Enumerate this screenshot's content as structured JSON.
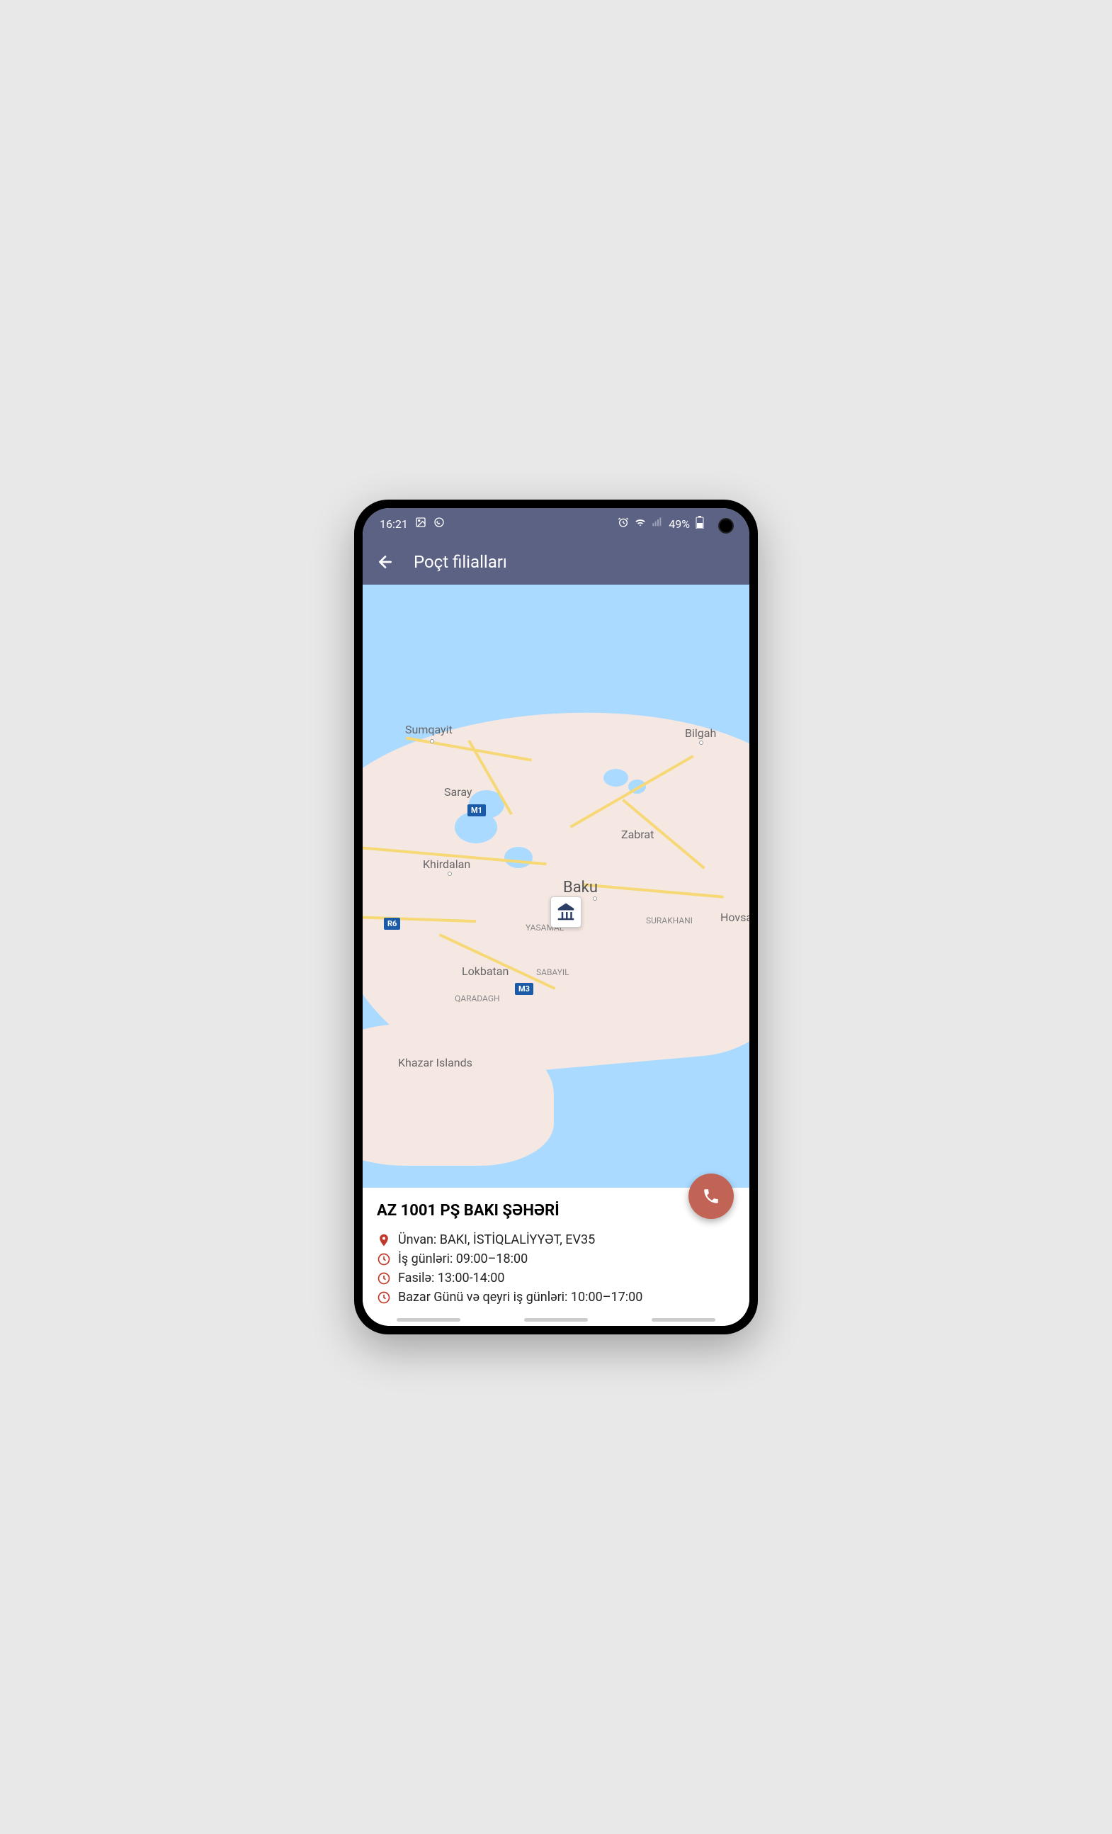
{
  "status": {
    "time": "16:21",
    "battery": "49%"
  },
  "header": {
    "title": "Poçt filialları"
  },
  "map": {
    "labels": {
      "sumqayit": "Sumqayit",
      "bilgah": "Bilgah",
      "saray": "Saray",
      "zabrat": "Zabrat",
      "khirdalan": "Khirdalan",
      "baku": "Baku",
      "hovsa": "Hovsa",
      "surakhani": "SURAKHANI",
      "yasamal": "YASAMAL",
      "lokbatan": "Lokbatan",
      "sabayil": "SABAYIL",
      "qaradagh": "QARADAGH",
      "khazar": "Khazar Islands"
    },
    "roads": {
      "m1": "M1",
      "m3": "M3",
      "r6": "R6"
    }
  },
  "branch": {
    "title": "AZ 1001 PŞ BAKI ŞƏHƏRİ",
    "address_label": "Ünvan:",
    "address_value": "BAKI, İSTİQLALİYYƏT, EV35",
    "workdays_label": "İş günləri:",
    "workdays_value": "09:00–18:00",
    "break_label": "Fasilə:",
    "break_value": "13:00-14:00",
    "sunday_label": "Bazar Günü və qeyri iş günləri:",
    "sunday_value": "10:00–17:00"
  }
}
